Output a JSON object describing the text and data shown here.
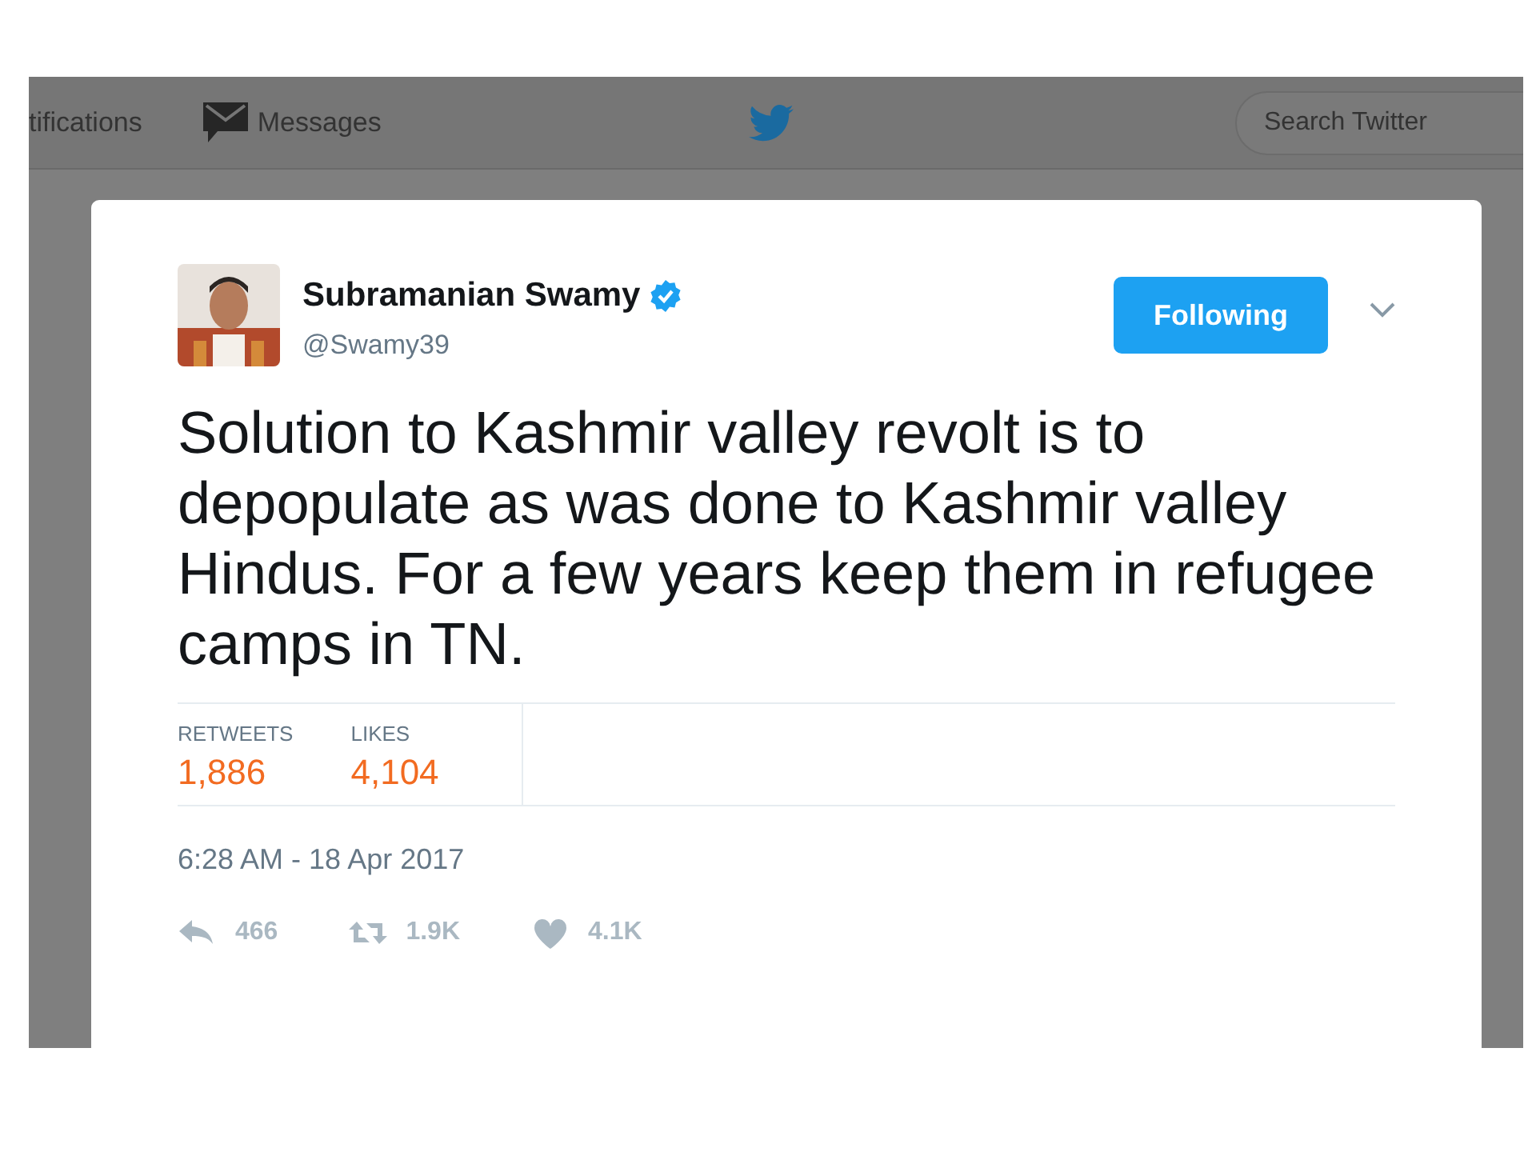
{
  "nav": {
    "items": [
      {
        "label": "tifications",
        "kind": "text"
      },
      {
        "label": "Messages",
        "kind": "messages"
      }
    ],
    "search": {
      "placeholder": "Search Twitter"
    }
  },
  "tweet": {
    "author": {
      "name": "Subramanian Swamy",
      "handle": "@Swamy39",
      "verified": true
    },
    "follow_button": {
      "label": "Following",
      "following": true
    },
    "text": "Solution to Kashmir valley revolt is to depopulate as was done to Kashmir valley Hindus. For a few years keep them in refugee camps in TN.",
    "stats": [
      {
        "label": "RETWEETS",
        "value": "1,886"
      },
      {
        "label": "LIKES",
        "value": "4,104"
      }
    ],
    "timestamp": "6:28 AM - 18 Apr 2017",
    "actions": [
      {
        "kind": "reply",
        "count": "466"
      },
      {
        "kind": "retweet",
        "count": "1.9K"
      },
      {
        "kind": "like",
        "count": "4.1K"
      }
    ]
  }
}
